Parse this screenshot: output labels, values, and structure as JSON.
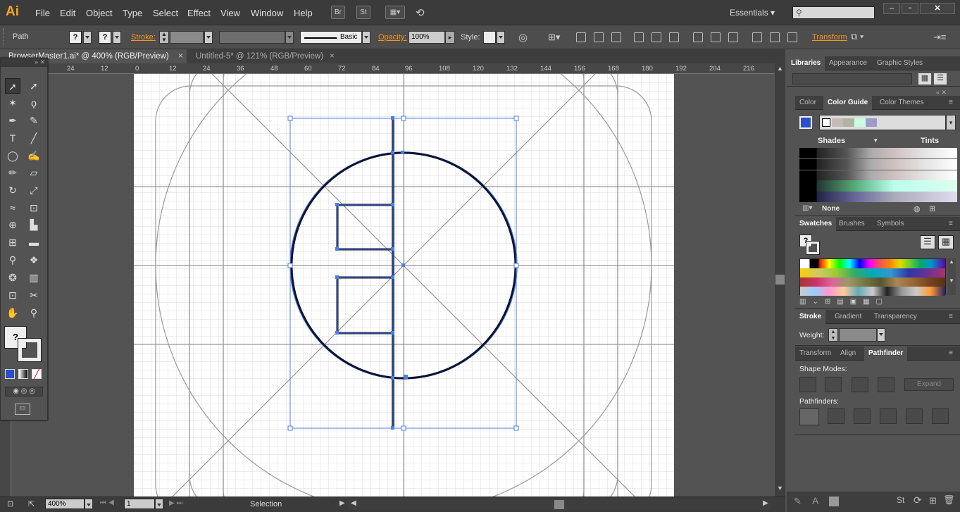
{
  "app": {
    "logo": "Ai"
  },
  "menu": [
    "File",
    "Edit",
    "Object",
    "Type",
    "Select",
    "Effect",
    "View",
    "Window",
    "Help"
  ],
  "menu_buttons": [
    "Br",
    "St"
  ],
  "workspace": "Essentials",
  "control": {
    "selection_type": "Path",
    "stroke_label": "Stroke:",
    "brush_label": "Basic",
    "opacity_label": "Opacity:",
    "opacity_value": "100%",
    "style_label": "Style:",
    "transform_label": "Transform",
    "fill_unknown": "?",
    "stroke_unknown": "?"
  },
  "tabs": [
    {
      "label": "BrowserMaster1.ai* @ 400% (RGB/Preview)",
      "close": "×"
    },
    {
      "label": "Untitled-5* @ 121% (RGB/Preview)",
      "close": "×"
    }
  ],
  "ruler_ticks": [
    "24",
    "12",
    "0",
    "12",
    "24",
    "36",
    "48",
    "60",
    "72",
    "84",
    "96",
    "108",
    "120",
    "132",
    "144",
    "156",
    "168",
    "180",
    "192",
    "204",
    "216"
  ],
  "status": {
    "zoom": "400%",
    "artboard": "1",
    "mode": "Selection"
  },
  "panels": {
    "top_tabs": [
      "Libraries",
      "Appearance",
      "Graphic Styles"
    ],
    "color_tabs": [
      "Color",
      "Color Guide",
      "Color Themes"
    ],
    "shades": "Shades",
    "tints": "Tints",
    "none_label": "None",
    "swatch_tabs": [
      "Swatches",
      "Brushes",
      "Symbols"
    ],
    "stroke_tabs": [
      "Stroke",
      "Gradient",
      "Transparency"
    ],
    "weight_label": "Weight:",
    "path_tabs": [
      "Transform",
      "Align",
      "Pathfinder"
    ],
    "shape_modes": "Shape Modes:",
    "expand": "Expand",
    "pathfinders": "Pathfinders:"
  },
  "colors": {
    "accent_orange": "#f7941d",
    "selection_blue": "#4d7ee8",
    "guide_harmony": [
      "#ffffff",
      "#c8b9b9",
      "#b3b3a1",
      "#c9ffe0",
      "#9b9cc9"
    ]
  }
}
